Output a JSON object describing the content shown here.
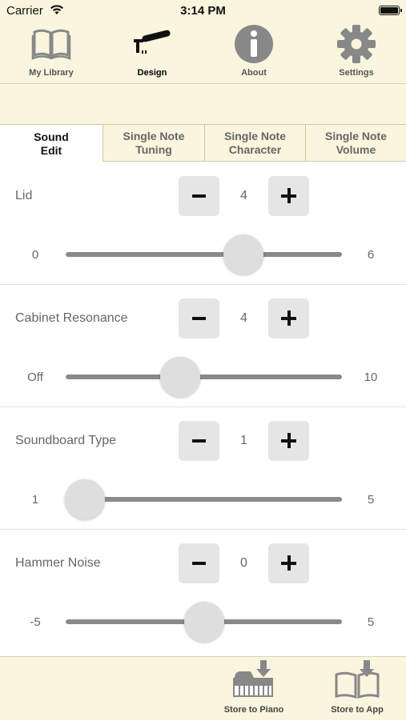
{
  "status_bar": {
    "carrier": "Carrier",
    "time": "3:14 PM"
  },
  "nav": {
    "items": [
      {
        "label": "My Library",
        "icon": "book-icon"
      },
      {
        "label": "Design",
        "icon": "hammer-icon"
      },
      {
        "label": "About",
        "icon": "info-icon"
      },
      {
        "label": "Settings",
        "icon": "gear-icon"
      }
    ],
    "active": "Design"
  },
  "tabs": [
    {
      "label": "Sound\nEdit",
      "active": true
    },
    {
      "label": "Single Note\nTuning",
      "active": false
    },
    {
      "label": "Single Note\nCharacter",
      "active": false
    },
    {
      "label": "Single Note\nVolume",
      "active": false
    }
  ],
  "params": [
    {
      "label": "Lid",
      "value": "4",
      "min_label": "0",
      "max_label": "6",
      "min": 0,
      "max": 6,
      "level": 4
    },
    {
      "label": "Cabinet Resonance",
      "value": "4",
      "min_label": "Off",
      "max_label": "10",
      "min": 0,
      "max": 10,
      "level": 4
    },
    {
      "label": "Soundboard Type",
      "value": "1",
      "min_label": "1",
      "max_label": "5",
      "min": 1,
      "max": 5,
      "level": 1
    },
    {
      "label": "Hammer Noise",
      "value": "0",
      "min_label": "-5",
      "max_label": "5",
      "min": -5,
      "max": 5,
      "level": 0
    }
  ],
  "bottom": {
    "store_piano": "Store to Piano",
    "store_app": "Store to App"
  },
  "colors": {
    "bar_bg": "#f9f5de",
    "icon_gray": "#888888",
    "button_bg": "#e5e5e5",
    "track": "#8a8a8a"
  }
}
